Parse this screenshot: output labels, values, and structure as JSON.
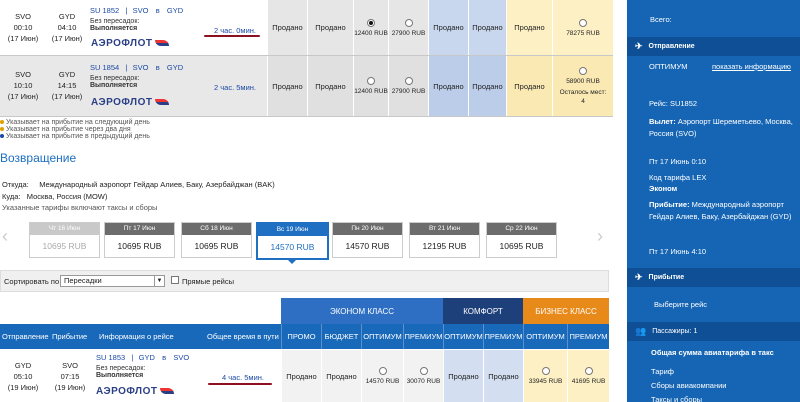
{
  "outbound": {
    "flights": [
      {
        "dep_code": "SVO",
        "arr_code": "GYD",
        "dep_time": "00:10",
        "arr_time": "04:10",
        "dep_date": "(17 Июн)",
        "arr_date": "(17 Июн)",
        "flight_no": "SU 1852",
        "route_from": "SVO",
        "route_via": "в",
        "route_to": "GYD",
        "nonstop_label": "Без пересадок:",
        "operated_label": "Выполняется",
        "carrier": "АЭРОФЛОТ",
        "duration": "2 час. 0мин.",
        "fares": [
          "Продано",
          "Продано",
          "12400 RUB",
          "27900 RUB",
          "Продано",
          "Продано",
          "Продано",
          "78275 RUB"
        ],
        "selected_fare": 2,
        "seats_left": ""
      },
      {
        "dep_code": "SVO",
        "arr_code": "GYD",
        "dep_time": "10:10",
        "arr_time": "14:15",
        "dep_date": "(17 Июн)",
        "arr_date": "(17 Июн)",
        "flight_no": "SU 1854",
        "route_from": "SVO",
        "route_via": "в",
        "route_to": "GYD",
        "nonstop_label": "Без пересадок:",
        "operated_label": "Выполняется",
        "carrier": "АЭРОФЛОТ",
        "duration": "2 час. 5мин.",
        "fares": [
          "Продано",
          "Продано",
          "12400 RUB",
          "27900 RUB",
          "Продано",
          "Продано",
          "Продано",
          "58900 RUB"
        ],
        "selected_fare": -1,
        "seats_left_label": "Осталось мест:",
        "seats_left": "4"
      }
    ],
    "legend": [
      {
        "text": "Указывает на прибытие на следующий день",
        "color": "#e0a000"
      },
      {
        "text": "Указывает на прибытие через два дня",
        "color": "#e0a000"
      },
      {
        "text": "Указывает на прибытие в предыдущий день",
        "color": "#1b49a5"
      }
    ]
  },
  "return": {
    "title": "Возвращение",
    "from_label": "Откуда:",
    "from_value": "Международный аэропорт Гейдар Алиев, Баку, Азербайджан (BAK)",
    "to_label": "Куда:",
    "to_value": "Москва, Россия (MOW)",
    "taxes_note": "Указанные тарифы включают таксы и сборы",
    "dates": [
      {
        "day": "Чт 16 Июн",
        "price": "10695 RUB",
        "state": "dis"
      },
      {
        "day": "Пт 17 Июн",
        "price": "10695 RUB",
        "state": ""
      },
      {
        "day": "Сб 18 Июн",
        "price": "10695 RUB",
        "state": ""
      },
      {
        "day": "Вс 19 Июн",
        "price": "14570 RUB",
        "state": "act"
      },
      {
        "day": "Пн 20 Июн",
        "price": "14570 RUB",
        "state": ""
      },
      {
        "day": "Вт 21 Июн",
        "price": "12195 RUB",
        "state": ""
      },
      {
        "day": "Ср 22 Июн",
        "price": "10695 RUB",
        "state": ""
      }
    ],
    "sort_label": "Сортировать по",
    "sort_value": "Пересадки",
    "direct_label": "Прямые рейсы",
    "classes": {
      "economy": "ЭКОНОМ КЛАСС",
      "comfort": "КОМФОРТ",
      "business": "БИЗНЕС КЛАСС"
    },
    "columns": {
      "departure": "Отправление",
      "arrival": "Прибытие",
      "info": "Информация о рейсе",
      "total_time": "Общее время в пути",
      "fares": [
        "ПРОМО",
        "БЮДЖЕТ",
        "ОПТИМУМ",
        "ПРЕМИУМ",
        "ОПТИМУМ",
        "ПРЕМИУМ",
        "ОПТИМУМ",
        "ПРЕМИУМ"
      ]
    },
    "flight": {
      "dep_code": "GYD",
      "arr_code": "SVO",
      "dep_time": "05:10",
      "arr_time": "07:15",
      "dep_date": "(19 Июн)",
      "arr_date": "(19 Июн)",
      "flight_no": "SU 1853",
      "route_from": "GYD",
      "route_via": "в",
      "route_to": "SVO",
      "nonstop_label": "Без пересадок:",
      "operated_label": "Выполняется",
      "carrier": "АЭРОФЛОТ",
      "duration": "4 час. 5мин.",
      "fares": [
        "Продано",
        "Продано",
        "14570 RUB",
        "30070 RUB",
        "Продано",
        "Продано",
        "33945 RUB",
        "41695 RUB"
      ]
    }
  },
  "sidebar": {
    "total_label": "Всего:",
    "outbound_header": "Отправление",
    "fare_name": "ОПТИМУМ",
    "show_info_link": "показать информацию",
    "flight_label": "Рейс: SU1852",
    "departure_label": "Вылет:",
    "departure_value": "Аэропорт Шереметьево, Москва, Россия (SVO)",
    "departure_time": "Пт 17 Июнь 0:10",
    "fare_code": "Код тарифа LEX",
    "fare_class": "Эконом",
    "arrival_label": "Прибытие:",
    "arrival_value": "Международный аэропорт Гейдар Алиев, Баку, Азербайджан (GYD)",
    "arrival_time": "Пт 17 Июнь 4:10",
    "arrival_header": "Прибытие",
    "choose_flight": "Выберите рейс",
    "passengers_header": "Пассажиры: 1",
    "total_fare_title": "Общая сумма авиатарифа в такс",
    "tariff_label": "Тариф",
    "airline_fees_label": "Сборы авиакомпании",
    "taxes_label": "Таксы и сборы"
  }
}
